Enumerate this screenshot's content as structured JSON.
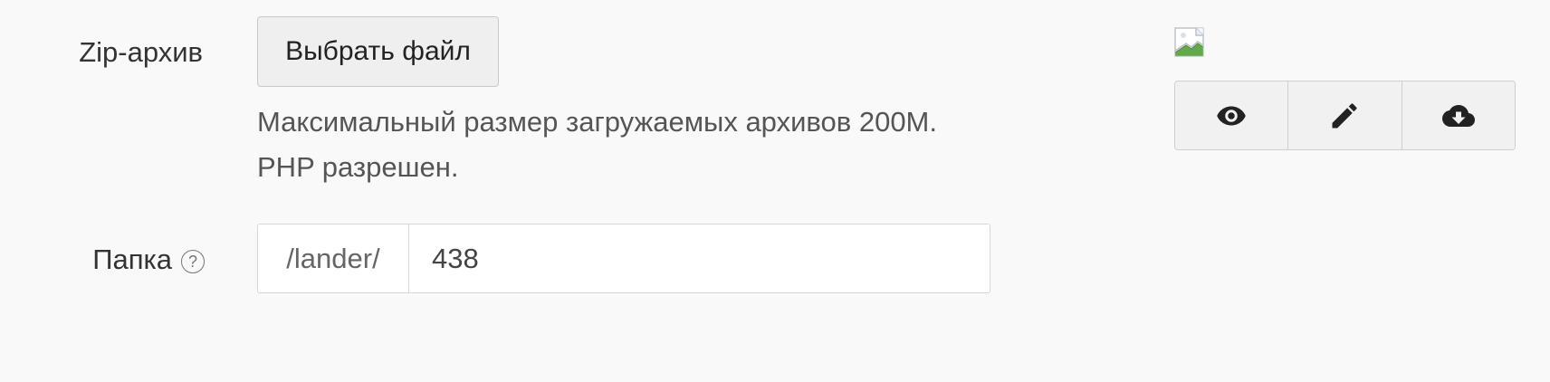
{
  "archive": {
    "label": "Zip-архив",
    "choose_file_button": "Выбрать файл",
    "hint_line1": "Максимальный размер загружаемых архивов 200M.",
    "hint_line2": "PHP разрешен."
  },
  "folder": {
    "label": "Папка",
    "help_symbol": "?",
    "prefix": "/lander/",
    "value": "438"
  },
  "preview_actions": {
    "items": [
      {
        "icon": "eye-icon"
      },
      {
        "icon": "pencil-icon"
      },
      {
        "icon": "cloud-download-icon"
      }
    ]
  },
  "colors": {
    "background": "#f9f9f9",
    "text": "#333333",
    "border": "#d6d6d6",
    "button_bg": "#efefef"
  }
}
